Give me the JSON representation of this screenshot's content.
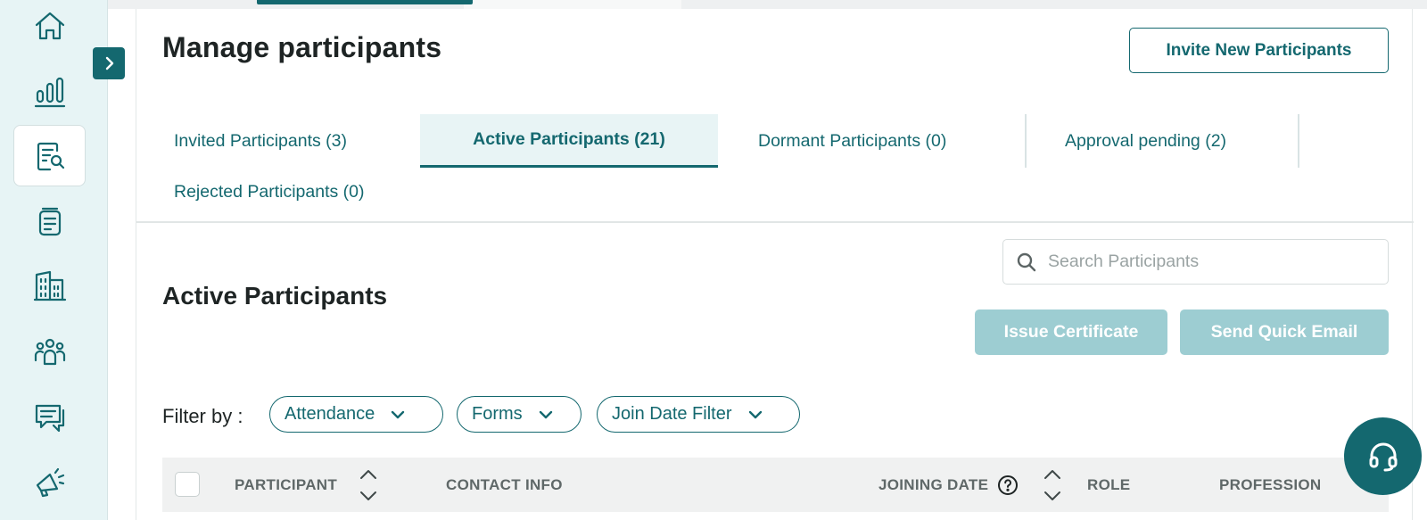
{
  "sidebar": {
    "items": [
      {
        "icon": "home-icon"
      },
      {
        "icon": "analytics-bars-icon"
      },
      {
        "icon": "document-search-icon",
        "active": true
      },
      {
        "icon": "notebook-icon"
      },
      {
        "icon": "buildings-icon"
      },
      {
        "icon": "people-group-icon"
      },
      {
        "icon": "chat-messages-icon"
      },
      {
        "icon": "megaphone-icon"
      }
    ],
    "expand_icon": "chevron-right-icon"
  },
  "header": {
    "title": "Manage participants",
    "invite_label": "Invite New Participants"
  },
  "tabs": [
    {
      "label": "Invited Participants (3)",
      "active": false
    },
    {
      "label": "Active Participants (21)",
      "active": true
    },
    {
      "label": "Dormant Participants (0)",
      "active": false
    },
    {
      "label": "Approval pending (2)",
      "active": false
    },
    {
      "label": "Rejected Participants (0)",
      "active": false
    }
  ],
  "section": {
    "title": "Active Participants",
    "search_placeholder": "Search Participants",
    "issue_certificate_label": "Issue Certificate",
    "send_email_label": "Send Quick Email"
  },
  "filters": {
    "label": "Filter by :",
    "options": [
      "Attendance",
      "Forms",
      "Join Date Filter"
    ]
  },
  "table": {
    "columns": [
      "PARTICIPANT",
      "CONTACT INFO",
      "JOINING DATE",
      "ROLE",
      "PROFESSION"
    ]
  },
  "colors": {
    "accent": "#14686f",
    "accent_light": "#e8f4f5",
    "disabled_button": "#9dcdd2",
    "sidebar_bg": "#e7f4f5"
  }
}
